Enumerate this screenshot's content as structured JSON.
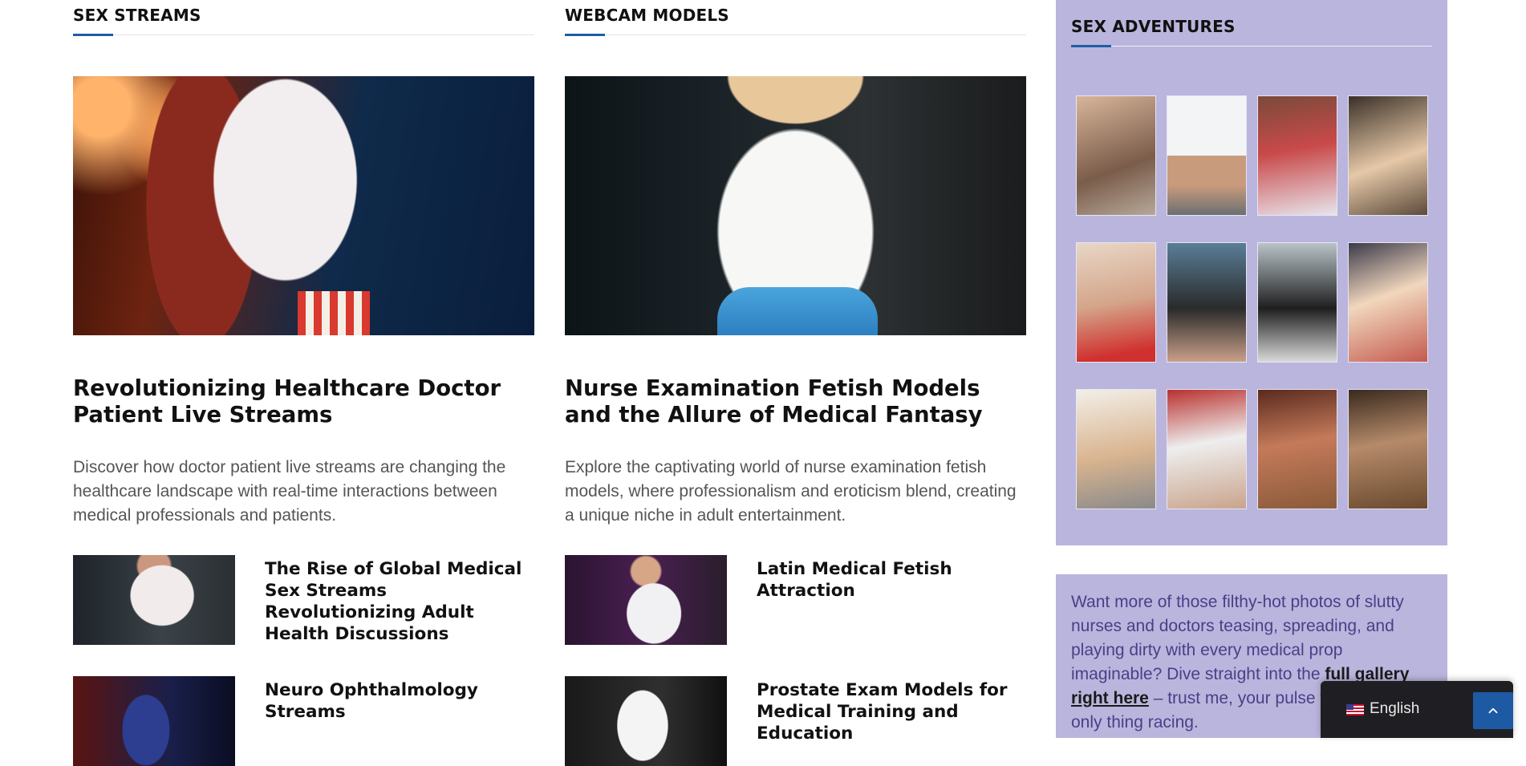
{
  "sections": [
    {
      "title": "SEX STREAMS",
      "featured": {
        "title": "Revolutionizing Healthcare Doctor Patient Live Streams",
        "excerpt": "Discover how doctor patient live streams are changing the healthcare landscape with real-time interactions between medical professionals and patients."
      },
      "list": [
        {
          "title": "The Rise of Global Medical Sex Streams Revolutionizing Adult Health Discussions"
        },
        {
          "title": "Neuro Ophthalmology Streams"
        }
      ]
    },
    {
      "title": "WEBCAM MODELS",
      "featured": {
        "title": "Nurse Examination Fetish Models and the Allure of Medical Fantasy",
        "excerpt": "Explore the captivating world of nurse examination fetish models, where professionalism and eroticism blend, creating a unique niche in adult entertainment."
      },
      "list": [
        {
          "title": "Latin Medical Fetish Attraction"
        },
        {
          "title": "Prostate Exam Models for Medical Training and Education"
        }
      ]
    }
  ],
  "sidebar": {
    "title": "SEX ADVENTURES",
    "gallery_count": 12,
    "promo": {
      "before": "Want more of those filthy-hot photos of slutty nurses and doctors teasing, spreading, and playing dirty with every medical prop imaginable? Dive straight into the ",
      "link": "full gallery right here",
      "after": " – trust me, your pulse won't be the only thing racing."
    }
  },
  "language": {
    "label": "English",
    "flag_icon": "us-flag-icon"
  },
  "scroll_top": {
    "icon": "chevron-up-icon"
  },
  "colors": {
    "accent": "#1e5ea8",
    "sidebar_bg": "#bab5dd",
    "promo_text": "#4a3f87"
  }
}
